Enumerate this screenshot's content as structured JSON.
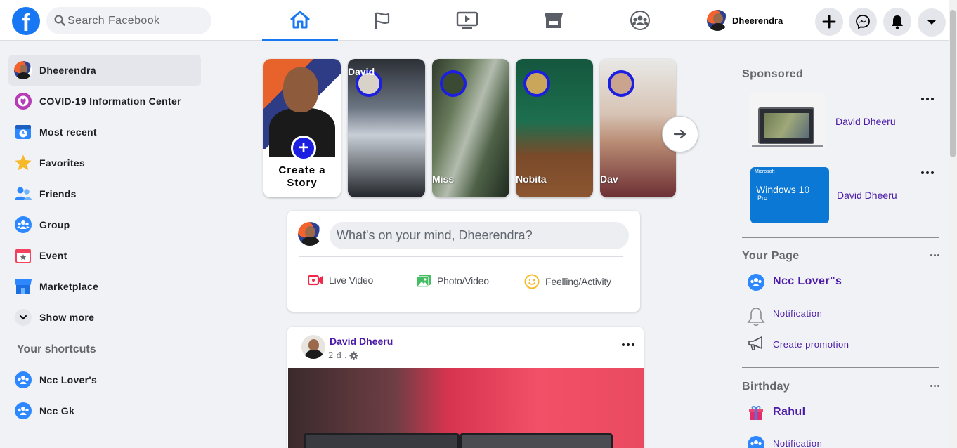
{
  "topbar": {
    "logo": "f",
    "search_placeholder": "Search Facebook",
    "nav_tabs": [
      {
        "name": "home",
        "icon": "home-icon",
        "active": true
      },
      {
        "name": "pages",
        "icon": "flag-icon",
        "active": false
      },
      {
        "name": "watch",
        "icon": "video-icon",
        "active": false
      },
      {
        "name": "marketplace",
        "icon": "store-icon",
        "active": false
      },
      {
        "name": "groups",
        "icon": "group-icon",
        "active": false
      }
    ],
    "profile_name": "Dheerendra",
    "action_icons": [
      "plus-icon",
      "messenger-icon",
      "bell-icon",
      "caret-down-icon"
    ]
  },
  "sidebar": {
    "items": [
      {
        "label": "Dheerendra",
        "icon": "avatar"
      },
      {
        "label": "COVID-19 Information Center",
        "icon": "covid-icon"
      },
      {
        "label": "Most recent",
        "icon": "clock-icon"
      },
      {
        "label": "Favorites",
        "icon": "star-icon"
      },
      {
        "label": "Friends",
        "icon": "friends-icon"
      },
      {
        "label": "Group",
        "icon": "group-icon"
      },
      {
        "label": "Event",
        "icon": "calendar-icon"
      },
      {
        "label": "Marketplace",
        "icon": "store-icon"
      },
      {
        "label": "Show more",
        "icon": "chevron-down-icon"
      }
    ],
    "shortcuts_title": "Your shortcuts",
    "shortcuts": [
      {
        "label": "Ncc Lover's"
      },
      {
        "label": "Ncc Gk"
      }
    ]
  },
  "stories": {
    "create_label": "Create  a Story",
    "items": [
      {
        "name": "David",
        "label_position": "top"
      },
      {
        "name": "Miss",
        "label_position": "bottom"
      },
      {
        "name": "Nobita",
        "label_position": "bottom"
      },
      {
        "name": "Dav",
        "label_position": "bottom"
      }
    ]
  },
  "composer": {
    "prompt": "What's on your mind, Dheerendra?",
    "actions": [
      {
        "label": "Live Video",
        "icon": "live-video-icon",
        "color": "#f02849"
      },
      {
        "label": "Photo/Video",
        "icon": "photo-icon",
        "color": "#45bd62"
      },
      {
        "label": "Feelling/Activity",
        "icon": "smile-icon",
        "color": "#f7b928"
      }
    ]
  },
  "post": {
    "author": "David Dheeru",
    "time": "2 d ."
  },
  "right": {
    "sponsored_title": "Sponsored",
    "ads": [
      {
        "name": "David Dheeru",
        "thumb": "laptop"
      },
      {
        "name": "David Dheeru",
        "thumb": "windows",
        "thumb_brand": "Microsoft",
        "thumb_title": "Windows 10",
        "thumb_subtitle": "Pro"
      }
    ],
    "your_page_title": "Your Page",
    "page_name": "Ncc Lover\"s",
    "page_links": [
      "Notification",
      "Create promotion"
    ],
    "birthday_title": "Birthday",
    "birthday_name": "Rahul",
    "birthday_link": "Notification"
  },
  "colors": {
    "brand": "#1877f2",
    "story_ring": "#1c1ee0",
    "link_purple": "#4b1aa8"
  }
}
